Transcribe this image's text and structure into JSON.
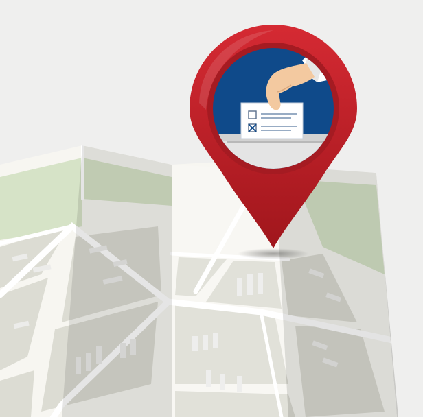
{
  "illustration": {
    "background_color": "#efefee",
    "map": {
      "paper_color": "#f7f6f1",
      "park_color": "#d6e3c7",
      "block_color": "#dcdcd3",
      "road_color": "#ffffff",
      "edge_color": "#c9c9c6",
      "fold_shadow": "#000000"
    },
    "pin": {
      "color": "#c8202a",
      "color_dark": "#8e1519",
      "inner_ring": "#a51b22",
      "disc_color": "#0f4a8a"
    },
    "ballot": {
      "paper_color": "#ffffff",
      "box_color": "#e4e4e4",
      "line_color": "#8aa0bb",
      "mark_color": "#0f4a8a",
      "hand_color": "#f3c9a0",
      "sleeve_color": "#ffffff"
    },
    "icons": [
      "map-icon",
      "location-pin-icon",
      "ballot-box-icon",
      "hand-icon",
      "checkbox-icon"
    ]
  }
}
